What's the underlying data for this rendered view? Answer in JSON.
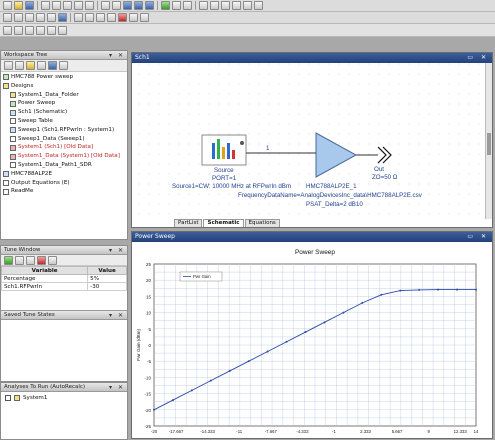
{
  "workspace": {
    "title": "Workspace Tree",
    "tree": [
      {
        "label": "HMC788 Power sweep",
        "level": 0,
        "icon": "workspace-icon"
      },
      {
        "label": "Designs",
        "level": 0,
        "icon": "folder-icon"
      },
      {
        "label": "System1_Data_Folder",
        "level": 1,
        "icon": "folder-icon"
      },
      {
        "label": "Power Sweep",
        "level": 1,
        "icon": "graph-icon"
      },
      {
        "label": "Sch1 (Schematic)",
        "level": 1,
        "icon": "schematic-icon"
      },
      {
        "label": "Sweep Table",
        "level": 1,
        "icon": "table-icon"
      },
      {
        "label": "Sweep1 (Sch1.RFPwrIn : System1)",
        "level": 1,
        "icon": "sweep-icon"
      },
      {
        "label": "Sweep1_Data (Sweep1)",
        "level": 1,
        "icon": "data-icon"
      },
      {
        "label": "System1 (Sch1) [Old Data]",
        "level": 1,
        "icon": "system-icon",
        "old": true
      },
      {
        "label": "System1_Data (System1) [Old Data]",
        "level": 1,
        "icon": "data-icon",
        "old": true
      },
      {
        "label": "System1_Data_Path1_SDR",
        "level": 1,
        "icon": "data-icon"
      },
      {
        "label": "HMC788ALP2E",
        "level": 0,
        "icon": "part-icon"
      },
      {
        "label": "Output Equations (E)",
        "level": 0,
        "icon": "equation-icon"
      },
      {
        "label": "ReadMe",
        "level": 0,
        "icon": "doc-icon"
      }
    ]
  },
  "tune": {
    "title": "Tune Window",
    "headers": [
      "Variable",
      "Value"
    ],
    "rows": [
      {
        "variable": "Percentage",
        "value": "5%"
      },
      {
        "variable": "Sch1.RFPwrIn",
        "value": "-30"
      }
    ],
    "saved_title": "Saved Tune States"
  },
  "analyses": {
    "title": "Analyses To Run (AutoRecalc)",
    "items": [
      "System1"
    ]
  },
  "schematic": {
    "title": "Sch1",
    "source_name": "Source",
    "source_port": "PORT=1",
    "source_def": "Source1=CW: 10000 MHz at RFPwrIn dBm",
    "node_label": "1",
    "amp_name": "HMC788ALP2E_1",
    "amp_file": "FrequencyDataName=AnalogDevicesInc_data\\HMC788ALP2E.csv",
    "amp_psat": "PSAT_Delta=2 dB10",
    "out_name": "Out",
    "out_z": "ZO=50 Ω",
    "tabs": [
      "PartList",
      "Schematic",
      "Equations"
    ]
  },
  "graph": {
    "window_title": "Power Sweep"
  },
  "chart_data": {
    "type": "line",
    "title": "Power Sweep",
    "legend": [
      "Pwr Gain"
    ],
    "x": [
      -20,
      -18,
      -16,
      -14,
      -12,
      -10,
      -8,
      -6,
      -4,
      -2,
      0,
      2,
      4,
      6,
      8,
      10,
      12,
      14
    ],
    "series": [
      {
        "name": "Pwr Gain",
        "values": [
          -20,
          -17,
          -14,
          -11,
          -8,
          -5,
          -2,
          1,
          4,
          7,
          10,
          13,
          15.5,
          16.8,
          17,
          17.1,
          17.1,
          17.1
        ]
      }
    ],
    "xticks": [
      "-20",
      "-17.667",
      "-14.333",
      "-11",
      "-7.667",
      "-4.333",
      "-1",
      "2.333",
      "5.667",
      "9",
      "12.333",
      "14"
    ],
    "yticks": [
      "25",
      "20",
      "15",
      "10",
      "5",
      "0",
      "-5",
      "-10",
      "-15",
      "-20",
      "-25"
    ],
    "ylabel": "Pwr Gain (dBm)",
    "xlim": [
      -20,
      14
    ],
    "ylim": [
      -25,
      25
    ],
    "grid": true,
    "colors": {
      "line": "#2a4aa8",
      "marker": "#2a4aa8",
      "grid": "#b7c6e4"
    }
  }
}
